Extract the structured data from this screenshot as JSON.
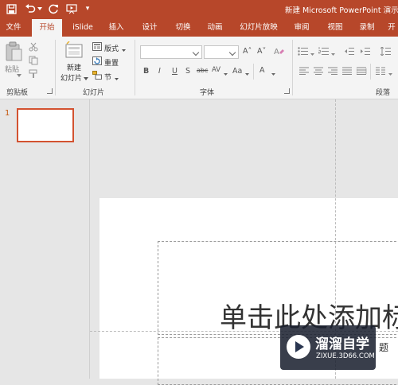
{
  "window": {
    "title": "新建 Microsoft PowerPoint 演示"
  },
  "qat": {
    "customize_label": "▾"
  },
  "tabs": [
    {
      "label": "文件"
    },
    {
      "label": "开始"
    },
    {
      "label": "iSlide"
    },
    {
      "label": "插入"
    },
    {
      "label": "设计"
    },
    {
      "label": "切换"
    },
    {
      "label": "动画"
    },
    {
      "label": "幻灯片放映"
    },
    {
      "label": "审阅"
    },
    {
      "label": "视图"
    },
    {
      "label": "录制"
    },
    {
      "label": "开"
    }
  ],
  "ribbon": {
    "clipboard": {
      "paste_label": "粘贴",
      "group_label": "剪贴板"
    },
    "slides": {
      "new_slide_label_1": "新建",
      "new_slide_label_2": "幻灯片",
      "layout_label": "版式",
      "reset_label": "重置",
      "section_label": "节",
      "group_label": "幻灯片"
    },
    "font": {
      "font_name": "",
      "font_size": "",
      "grow": "A˄",
      "shrink": "A˅",
      "bold": "B",
      "italic": "I",
      "underline": "U",
      "shadow": "S",
      "strike": "abc",
      "spacing": "AV",
      "case": "Aa",
      "color": "A",
      "group_label": "字体"
    },
    "paragraph": {
      "group_label": "段落"
    }
  },
  "thumbnails": {
    "slide_number": "1"
  },
  "slide": {
    "title_placeholder": "单击此处添加标",
    "subtitle_placeholder": "题"
  },
  "watermark": {
    "title": "溜溜自学",
    "subtitle": "ZIXUE.3D66.COM"
  }
}
